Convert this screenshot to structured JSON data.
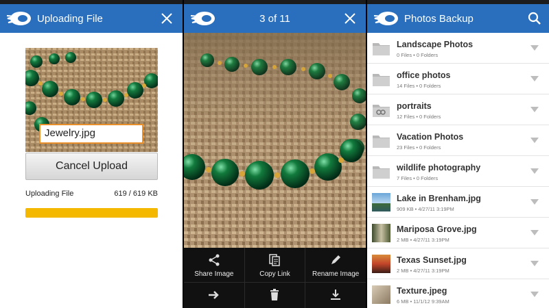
{
  "upload_panel": {
    "title": "Uploading File",
    "filename": "Jewelry.jpg",
    "cancel_label": "Cancel Upload",
    "status_label": "Uploading File",
    "size_text": "619 / 619 KB",
    "progress_fraction": 1.0
  },
  "viewer_panel": {
    "title": "3 of 11",
    "actions": [
      {
        "label": "Share Image",
        "icon": "share-icon"
      },
      {
        "label": "Copy Link",
        "icon": "copy-link-icon"
      },
      {
        "label": "Rename Image",
        "icon": "rename-icon"
      },
      {
        "label": "",
        "icon": "move-icon"
      },
      {
        "label": "",
        "icon": "delete-icon"
      },
      {
        "label": "",
        "icon": "download-icon"
      }
    ]
  },
  "browser_panel": {
    "title": "Photos Backup",
    "items": [
      {
        "name": "Landscape Photos",
        "meta": "0 Files • 0 Folders",
        "kind": "folder"
      },
      {
        "name": "office photos",
        "meta": "14 Files • 0 Folders",
        "kind": "folder"
      },
      {
        "name": "portraits",
        "meta": "12 Files • 0 Folders",
        "kind": "shared-folder"
      },
      {
        "name": "Vacation Photos",
        "meta": "23 Files • 0 Folders",
        "kind": "folder"
      },
      {
        "name": "wildlife photography",
        "meta": "7 Files • 0 Folders",
        "kind": "folder"
      },
      {
        "name": "Lake in Brenham.jpg",
        "meta": "909 KB • 4/27/11 3:19PM",
        "kind": "image"
      },
      {
        "name": "Mariposa Grove.jpg",
        "meta": "2 MB • 4/27/11 3:19PM",
        "kind": "image"
      },
      {
        "name": "Texas Sunset.jpg",
        "meta": "2 MB • 4/27/11 3:19PM",
        "kind": "image"
      },
      {
        "name": "Texture.jpeg",
        "meta": "6 MB • 11/1/12 9:39AM",
        "kind": "image"
      }
    ]
  },
  "colors": {
    "appbar": "#2a6fbd",
    "progress": "#f5b800",
    "filename_border": "#e9902a"
  }
}
